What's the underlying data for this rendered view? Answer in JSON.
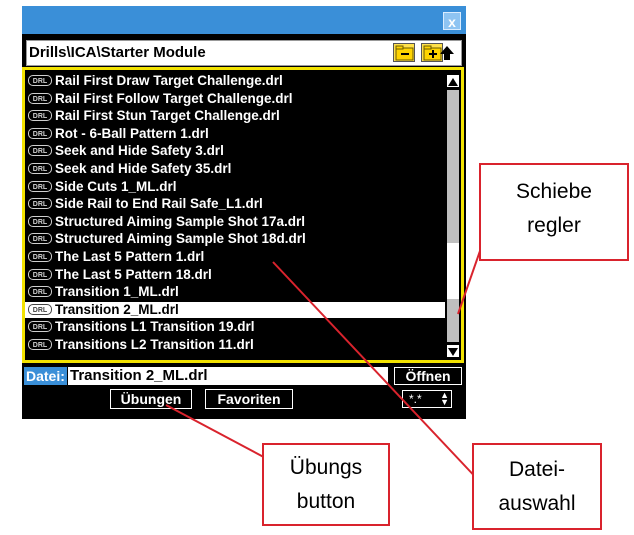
{
  "dialog": {
    "close_label": "x",
    "path": "Drills\\ICA\\Starter Module",
    "files": [
      "Rail First Draw Target Challenge.drl",
      "Rail First Follow Target Challenge.drl",
      "Rail First Stun Target Challenge.drl",
      "Rot - 6-Ball Pattern 1.drl",
      "Seek and Hide Safety 3.drl",
      "Seek and Hide Safety 35.drl",
      "Side Cuts 1_ML.drl",
      "Side Rail to End Rail Safe_L1.drl",
      "Structured Aiming Sample Shot 17a.drl",
      "Structured Aiming Sample Shot 18d.drl",
      "The Last 5 Pattern 1.drl",
      "The Last 5 Pattern 18.drl",
      "Transition 1_ML.drl",
      "Transition 2_ML.drl",
      "Transitions L1 Transition 19.drl",
      "Transitions L2 Transition 11.drl"
    ],
    "selected_index": 13,
    "file_icon_label": "DRL",
    "file_label": "Datei:",
    "file_value": "Transition 2_ML.drl",
    "open_label": "Öffnen",
    "tab_exercises": "Übungen",
    "tab_favorites": "Favoriten",
    "filter_value": "*.*",
    "scroll_position": 0.78
  },
  "callouts": {
    "slider": [
      "Schiebe",
      "regler"
    ],
    "exercises": [
      "Übungs",
      "button"
    ],
    "file_select": [
      "Datei-",
      "auswahl"
    ]
  },
  "colors": {
    "titlebar": "#3a8fd8",
    "list_border": "#f2e200",
    "callout_border": "#d9232d"
  }
}
